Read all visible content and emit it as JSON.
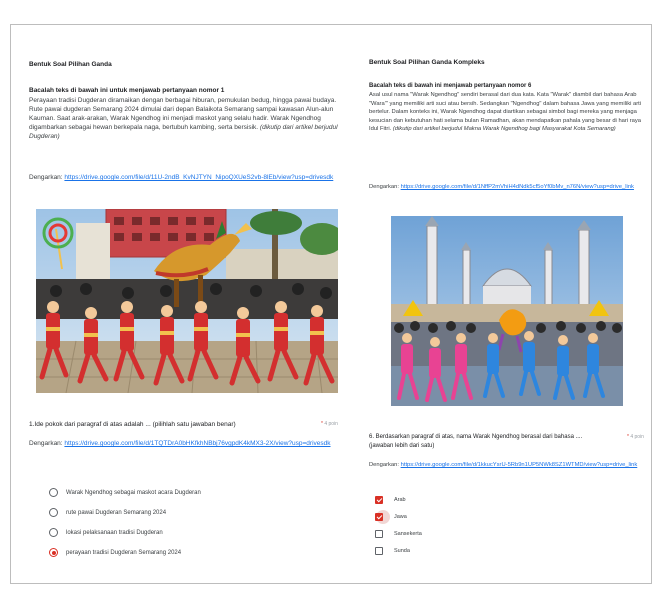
{
  "left": {
    "section_title": "Bentuk Soal Pilihan Ganda",
    "instruction": "Bacalah teks di bawah ini untuk menjawab pertanyaan nomor 1",
    "paragraph": "Perayaan tradisi Dugderan diramaikan dengan berbagai hiburan, pemukulan bedug, hingga pawai budaya. Rute pawai dugderan Semarang 2024 dimulai dari depan Balaikota Semarang sampai kawasan Alun-alun Kauman. Saat arak-arakan, Warak Ngendhog ini menjadi maskot yang selalu hadir. Warak Ngendhog digambarkan sebagai hewan berkepala naga, bertubuh kambing, serta bersisik.",
    "paragraph_source": "(dikutip dari artikel berjudul Dugderan)",
    "listen_label": "Dengarkan:",
    "listen_link": "https://drive.google.com/file/d/11U-2ndB_KvNJTYN_NipoQXUeS2vb-8lEb/view?usp=drivesdk",
    "question": "1.Ide pokok dari paragraf di atas adalah ... (pilihlah satu jawaban benar)",
    "points": "4 poin",
    "question_listen_label": "Dengarkan:",
    "question_listen_link": "https://drive.google.com/file/d/1TQTDrA0bHKfkhNBbj76vgpdK4kMX3-2X/view?usp=drivesdk",
    "options": [
      {
        "label": "Warak Ngendhog sebagai maskot acara Dugderan",
        "selected": false
      },
      {
        "label": "rute pawai Dugderan Semarang 2024",
        "selected": false
      },
      {
        "label": "lokasi pelaksanaan tradisi Dugderan",
        "selected": false
      },
      {
        "label": "perayaan tradisi Dugderan Semarang 2024",
        "selected": true
      }
    ]
  },
  "right": {
    "section_title": "Bentuk Soal Pilihan Ganda Kompleks",
    "instruction": "Bacalah teks di bawah ini menjawab pertanyaan nomor 6",
    "paragraph": "Asal usul nama \"Warak Ngendhog\" sendiri berasal dari dua kata. Kata \"Warak\" diambil dari bahasa Arab \"Wara'\" yang memiliki arti suci atau bersih. Sedangkan \"Ngendhog\" dalam bahasa Jawa yang memiliki arti bertelur. Dalam konteks ini, Warak Ngendhog dapat diartikan sebagai simbol bagi mereka yang menjaga kesucian dan kebutuhan hati selama bulan Ramadhan, akan mendapatkan pahala yang besar di hari raya Idul Fitri.",
    "paragraph_source": "(dikutip dari artikel berjudul Makna Warak Ngendhog bagi Masyarakat Kota Semarang)",
    "listen_label": "Dengarkan:",
    "listen_link": "https://drive.google.com/file/d/1NffP2mVhiH4dNdk5cf5oYf0bMv_n76N/view?usp=drive_link",
    "question": "6. Berdasarkan paragraf di atas, nama Warak Ngendhog berasal dari bahasa .... (jawaban lebih dari satu)",
    "points": "4 poin",
    "question_listen_label": "Dengarkan:",
    "question_listen_link": "https://drive.google.com/file/d/1kkucYsrU-5Rb9n1UP5NWk8SZ1WTMD/view?usp=drive_link",
    "options": [
      {
        "label": "Arab",
        "checked": true
      },
      {
        "label": "Jawa",
        "checked": true
      },
      {
        "label": "Sansekerta",
        "checked": false
      },
      {
        "label": "Sunda",
        "checked": false
      }
    ]
  },
  "colors": {
    "accent": "#d93025",
    "link": "#1a73e8"
  }
}
